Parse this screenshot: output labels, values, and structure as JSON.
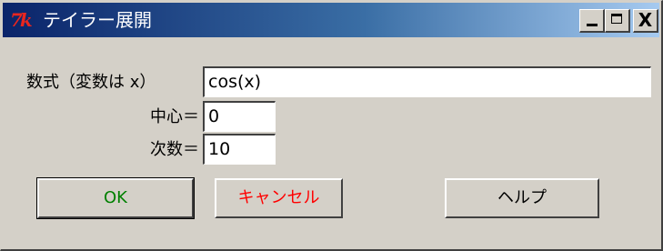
{
  "window": {
    "title": "テイラー展開",
    "icon_label": "7k",
    "controls": {
      "minimize": "minimize-icon",
      "maximize": "maximize-icon",
      "close": "close-icon",
      "close_label": "X"
    }
  },
  "form": {
    "expression_label": "数式（変数は x）",
    "expression_value": "cos(x)",
    "center_label": "中心＝",
    "center_value": "0",
    "degree_label": "次数＝",
    "degree_value": "10"
  },
  "buttons": {
    "ok_label": "OK",
    "cancel_label": "キャンセル",
    "help_label": "ヘルプ"
  },
  "colors": {
    "titlebar_start": "#0a246a",
    "titlebar_end": "#a6caf0",
    "ok_text": "#008000",
    "cancel_text": "#ff0000",
    "face": "#d4d0c8",
    "icon_red": "#e8261f"
  }
}
